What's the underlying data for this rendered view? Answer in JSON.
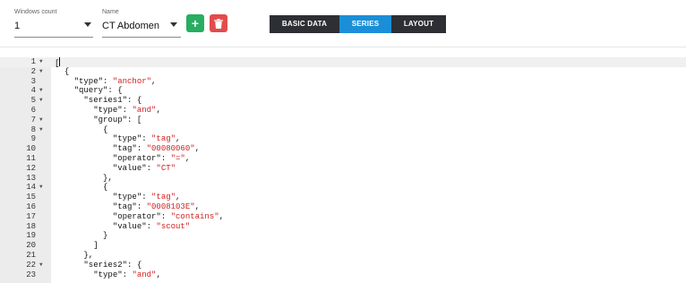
{
  "toolbar": {
    "windows_count": {
      "label": "Windows count",
      "value": "1"
    },
    "name": {
      "label": "Name",
      "value": "CT Abdomen"
    },
    "add_label": "+",
    "tabs": [
      {
        "label": "BASIC DATA",
        "active": false
      },
      {
        "label": "SERIES",
        "active": true
      },
      {
        "label": "LAYOUT",
        "active": false
      }
    ],
    "colors": {
      "add": "#27ae60",
      "delete": "#e24c4c",
      "active_tab": "#1a8fd8",
      "tab_bar": "#2c2f33"
    }
  },
  "editor": {
    "lines": [
      {
        "n": "1",
        "fold": true,
        "indent": "",
        "parts": [
          [
            "p",
            "["
          ]
        ]
      },
      {
        "n": "2",
        "fold": true,
        "indent": "  ",
        "parts": [
          [
            "p",
            "{"
          ]
        ]
      },
      {
        "n": "3",
        "fold": false,
        "indent": "    ",
        "parts": [
          [
            "p",
            "\"type\": "
          ],
          [
            "s",
            "\"anchor\""
          ],
          [
            "p",
            ","
          ]
        ]
      },
      {
        "n": "4",
        "fold": true,
        "indent": "    ",
        "parts": [
          [
            "p",
            "\"query\": {"
          ]
        ]
      },
      {
        "n": "5",
        "fold": true,
        "indent": "      ",
        "parts": [
          [
            "p",
            "\"series1\": {"
          ]
        ]
      },
      {
        "n": "6",
        "fold": false,
        "indent": "        ",
        "parts": [
          [
            "p",
            "\"type\": "
          ],
          [
            "s",
            "\"and\""
          ],
          [
            "p",
            ","
          ]
        ]
      },
      {
        "n": "7",
        "fold": true,
        "indent": "        ",
        "parts": [
          [
            "p",
            "\"group\": ["
          ]
        ]
      },
      {
        "n": "8",
        "fold": true,
        "indent": "          ",
        "parts": [
          [
            "p",
            "{"
          ]
        ]
      },
      {
        "n": "9",
        "fold": false,
        "indent": "            ",
        "parts": [
          [
            "p",
            "\"type\": "
          ],
          [
            "s",
            "\"tag\""
          ],
          [
            "p",
            ","
          ]
        ]
      },
      {
        "n": "10",
        "fold": false,
        "indent": "            ",
        "parts": [
          [
            "p",
            "\"tag\": "
          ],
          [
            "s",
            "\"00080060\""
          ],
          [
            "p",
            ","
          ]
        ]
      },
      {
        "n": "11",
        "fold": false,
        "indent": "            ",
        "parts": [
          [
            "p",
            "\"operator\": "
          ],
          [
            "s",
            "\"=\""
          ],
          [
            "p",
            ","
          ]
        ]
      },
      {
        "n": "12",
        "fold": false,
        "indent": "            ",
        "parts": [
          [
            "p",
            "\"value\": "
          ],
          [
            "s",
            "\"CT\""
          ]
        ]
      },
      {
        "n": "13",
        "fold": false,
        "indent": "          ",
        "parts": [
          [
            "p",
            "},"
          ]
        ]
      },
      {
        "n": "14",
        "fold": true,
        "indent": "          ",
        "parts": [
          [
            "p",
            "{"
          ]
        ]
      },
      {
        "n": "15",
        "fold": false,
        "indent": "            ",
        "parts": [
          [
            "p",
            "\"type\": "
          ],
          [
            "s",
            "\"tag\""
          ],
          [
            "p",
            ","
          ]
        ]
      },
      {
        "n": "16",
        "fold": false,
        "indent": "            ",
        "parts": [
          [
            "p",
            "\"tag\": "
          ],
          [
            "s",
            "\"0008103E\""
          ],
          [
            "p",
            ","
          ]
        ]
      },
      {
        "n": "17",
        "fold": false,
        "indent": "            ",
        "parts": [
          [
            "p",
            "\"operator\": "
          ],
          [
            "s",
            "\"contains\""
          ],
          [
            "p",
            ","
          ]
        ]
      },
      {
        "n": "18",
        "fold": false,
        "indent": "            ",
        "parts": [
          [
            "p",
            "\"value\": "
          ],
          [
            "s",
            "\"scout\""
          ]
        ]
      },
      {
        "n": "19",
        "fold": false,
        "indent": "          ",
        "parts": [
          [
            "p",
            "}"
          ]
        ]
      },
      {
        "n": "20",
        "fold": false,
        "indent": "        ",
        "parts": [
          [
            "p",
            "]"
          ]
        ]
      },
      {
        "n": "21",
        "fold": false,
        "indent": "      ",
        "parts": [
          [
            "p",
            "},"
          ]
        ]
      },
      {
        "n": "22",
        "fold": true,
        "indent": "      ",
        "parts": [
          [
            "p",
            "\"series2\": {"
          ]
        ]
      },
      {
        "n": "23",
        "fold": false,
        "indent": "        ",
        "parts": [
          [
            "p",
            "\"type\": "
          ],
          [
            "s",
            "\"and\""
          ],
          [
            "p",
            ","
          ]
        ]
      }
    ],
    "colors": {
      "string": "#d11f1f",
      "gutter": "#ececec"
    }
  }
}
